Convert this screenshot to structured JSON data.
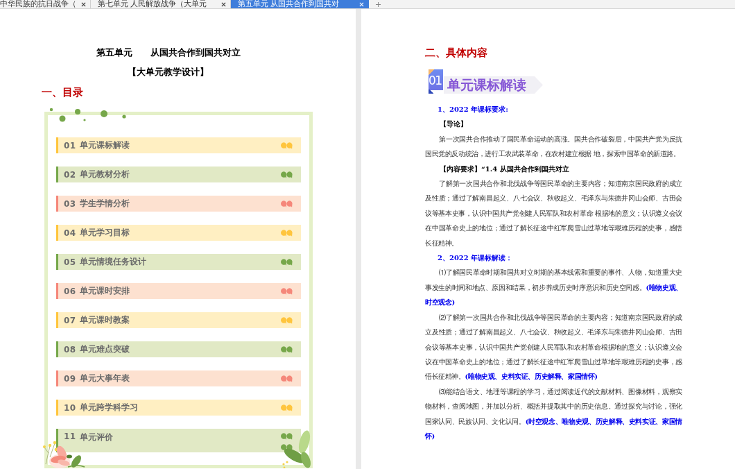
{
  "tabs": [
    {
      "label": "中华民族的抗日战争（",
      "selected": false
    },
    {
      "label": "第七单元 人民解放战争（大单元",
      "selected": false
    },
    {
      "label": "第五单元 从国共合作到国共对",
      "selected": true
    }
  ],
  "left_page": {
    "title": "第五单元　　从国共合作到国共对立",
    "subtitle": "【大单元教学设计】",
    "section_heading": "一、目录",
    "toc": {
      "items": [
        {
          "number": "01",
          "label": "单元课标解读",
          "color": "#ffc53d",
          "kind": "single"
        },
        {
          "number": "02",
          "label": "单元教材分析",
          "color": "#76a74a",
          "kind": "single"
        },
        {
          "number": "03",
          "label": "学生学情分析",
          "color": "#f5877a",
          "kind": "single"
        },
        {
          "number": "04",
          "label": "单元学习目标",
          "color": "#ffc53d",
          "kind": "single"
        },
        {
          "number": "05",
          "label": "单元情境任务设计",
          "color": "#76a74a",
          "kind": "single"
        },
        {
          "number": "06",
          "label": "单元课时安排",
          "color": "#f5877a",
          "kind": "single"
        },
        {
          "number": "07",
          "label": "单元课时教案",
          "color": "#ffc53d",
          "kind": "single"
        },
        {
          "number": "08",
          "label": "单元难点突破",
          "color": "#76a74a",
          "kind": "single"
        },
        {
          "number": "09",
          "label": "单元大事年表",
          "color": "#f5877a",
          "kind": "single"
        },
        {
          "number": "10",
          "label": "单元跨学科学习",
          "color": "#ffc53d",
          "kind": "single"
        },
        {
          "number": "11",
          "label": "单元评价",
          "color": "#76a74a",
          "kind": "double"
        }
      ]
    }
  },
  "right_page": {
    "section_heading": "二、具体内容",
    "banner": {
      "number": "01",
      "title": "单元课标解读"
    },
    "blocks": [
      {
        "kind": "heading",
        "text": "1、2022 年课标要求:"
      },
      {
        "kind": "label",
        "text": "【导论】"
      },
      {
        "kind": "paragraph",
        "text": "第一次国共合作推动了国民革命运动的高涨。国共合作破裂后，中国共产党为反抗国民党的反动统治，进行工农武装革命，在农村建立根据 地，探索中国革命的新道路。"
      },
      {
        "kind": "label",
        "text": "【内容要求】“1.4 从国共合作到国共对立"
      },
      {
        "kind": "paragraph",
        "text": "了解第一次国共合作和北伐战争等国民革命的主要内容；知道南京国民政府的成立及性质；通过了解南昌起义、八七会议、秋收起义、毛泽东与朱德井冈山会师、古田会议等基本史事，认识中国共产党创建人民军队和农村革命 根据地的意义；认识遵义会议在中国革命史上的地位；通过了解长征途中红军爬雪山过草地等艰难历程的史事，感悟长征精神。"
      },
      {
        "kind": "heading",
        "text": "2、2022 年课标解读："
      },
      {
        "kind": "paragraph",
        "text": "⑴了解国民革命时期和国共对立时期的基本线索和重要的事件、人物，知道重大史事发生的时间和地点、原因和结果，初步养成历史时序意识和历史空间感。**(唯物史观、时空观念)**"
      },
      {
        "kind": "paragraph",
        "text": "⑵了解第一次国共合作和北伐战争等国民革命的主要内容；知道南京国民政府的成立及性质；通过了解南昌起义、八七会议、秋收起义、毛泽东与朱德井冈山会师、古田会议等基本史事，认识中国共产党创建人民军队和农村革命根据地的意义；认识遵义会议在中国革命史上的地位；通过了解长征途中红军爬雪山过草地等艰难历程的史事，感悟长征精神。**(唯物史观、史料实证、历史解释、家国情怀)**"
      },
      {
        "kind": "paragraph",
        "text": "⑶能结合语文、地理等课程的学习，通过阅读近代的文献材料、图像材料，观察实物材料，查阅地图，并加以分析、概括并提取其中的历史信息。通过探究与讨论，强化国家认同、民族认同、文化认同。**(时空观念、唯物史观、历史解释、史料实证、家国情怀)**"
      }
    ]
  }
}
